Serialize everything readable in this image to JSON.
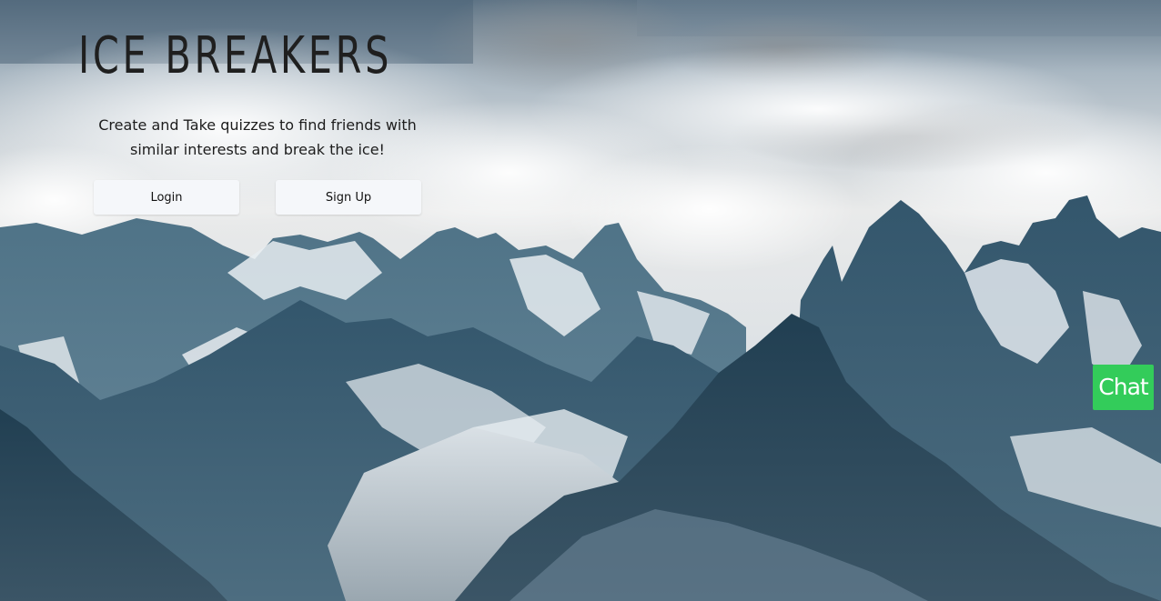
{
  "landing": {
    "brand": "ICE BREAKERS",
    "tagline": "Create and Take quizzes to find friends with similar interests and break the ice!",
    "login_label": "Login",
    "signup_label": "Sign Up"
  },
  "chat_widget": {
    "label": "Chat",
    "color": "#33cc5a"
  },
  "background": {
    "image": "mountain-range-photo",
    "sky_color": "#e6e8ea",
    "rock_color": "#2c5066"
  }
}
